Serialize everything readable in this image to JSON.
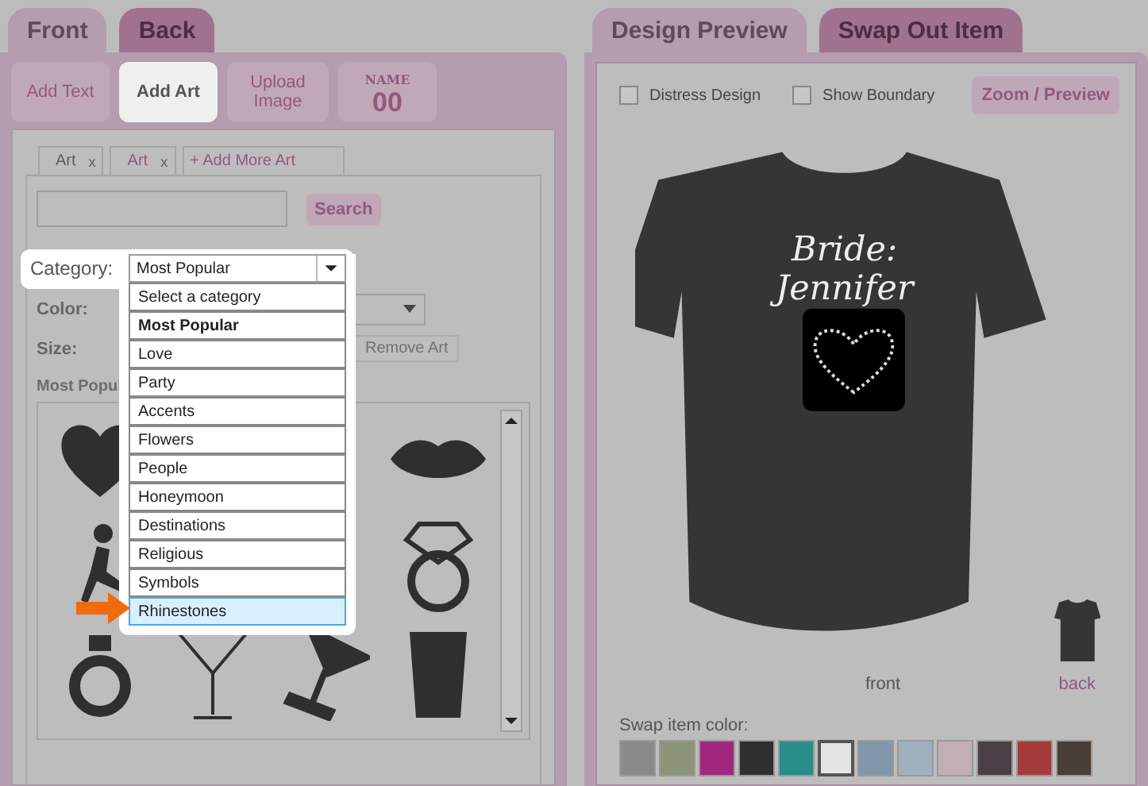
{
  "side_tabs": [
    {
      "label": "Front",
      "selected": true
    },
    {
      "label": "Back",
      "selected": false
    }
  ],
  "tools": [
    {
      "kind": "text",
      "label": "Add Text",
      "selected": false
    },
    {
      "kind": "text",
      "label": "Add Art",
      "selected": true
    },
    {
      "kind": "text",
      "label": "Upload Image",
      "selected": false
    },
    {
      "kind": "name_number",
      "label": "NAME",
      "number": "00",
      "selected": false
    }
  ],
  "art_tabs": [
    {
      "label": "Art",
      "close": "x",
      "selected": true
    },
    {
      "label": "Art",
      "close": "x",
      "selected": false
    }
  ],
  "add_more_art": "+ Add More Art",
  "search": {
    "button": "Search"
  },
  "category": {
    "label": "Category:",
    "value": "Most Popular",
    "options": [
      {
        "label": "Select a category",
        "selected": false,
        "highlighted": false
      },
      {
        "label": "Most Popular",
        "selected": true,
        "highlighted": false
      },
      {
        "label": "Love",
        "selected": false,
        "highlighted": false
      },
      {
        "label": "Party",
        "selected": false,
        "highlighted": false
      },
      {
        "label": "Accents",
        "selected": false,
        "highlighted": false
      },
      {
        "label": "Flowers",
        "selected": false,
        "highlighted": false
      },
      {
        "label": "People",
        "selected": false,
        "highlighted": false
      },
      {
        "label": "Honeymoon",
        "selected": false,
        "highlighted": false
      },
      {
        "label": "Destinations",
        "selected": false,
        "highlighted": false
      },
      {
        "label": "Religious",
        "selected": false,
        "highlighted": false
      },
      {
        "label": "Symbols",
        "selected": false,
        "highlighted": false
      },
      {
        "label": "Rhinestones",
        "selected": false,
        "highlighted": true
      }
    ]
  },
  "color_label": "Color:",
  "size_label": "Size:",
  "remove_art": "Remove Art",
  "gallery_title": "Most Popul",
  "preview_tabs": [
    {
      "label": "Design Preview",
      "selected": true
    },
    {
      "label": "Swap Out Item",
      "selected": false
    }
  ],
  "options": [
    {
      "label": "Distress Design",
      "checked": false
    },
    {
      "label": "Show Boundary",
      "checked": false
    }
  ],
  "zoom_button": "Zoom / Preview",
  "shirt": {
    "design_text": "Bride:",
    "design_text_2": "Jennifer"
  },
  "views": [
    {
      "label": "front",
      "selected": true
    },
    {
      "label": "back",
      "selected": false
    }
  ],
  "swap_label": "Swap item color:",
  "swatches": [
    {
      "color": "#8a8a8a",
      "selected": false
    },
    {
      "color": "#8c9479",
      "selected": false
    },
    {
      "color": "#a1287e",
      "selected": false
    },
    {
      "color": "#2f2f2f",
      "selected": false
    },
    {
      "color": "#2a8e8b",
      "selected": false
    },
    {
      "color": "#e3e3e3",
      "selected": true
    },
    {
      "color": "#8296aa",
      "selected": false
    },
    {
      "color": "#a0b1be",
      "selected": false
    },
    {
      "color": "#c3aeb3",
      "selected": false
    },
    {
      "color": "#4b3f46",
      "selected": false
    },
    {
      "color": "#a33b3b",
      "selected": false
    },
    {
      "color": "#4a3f38",
      "selected": false
    }
  ]
}
